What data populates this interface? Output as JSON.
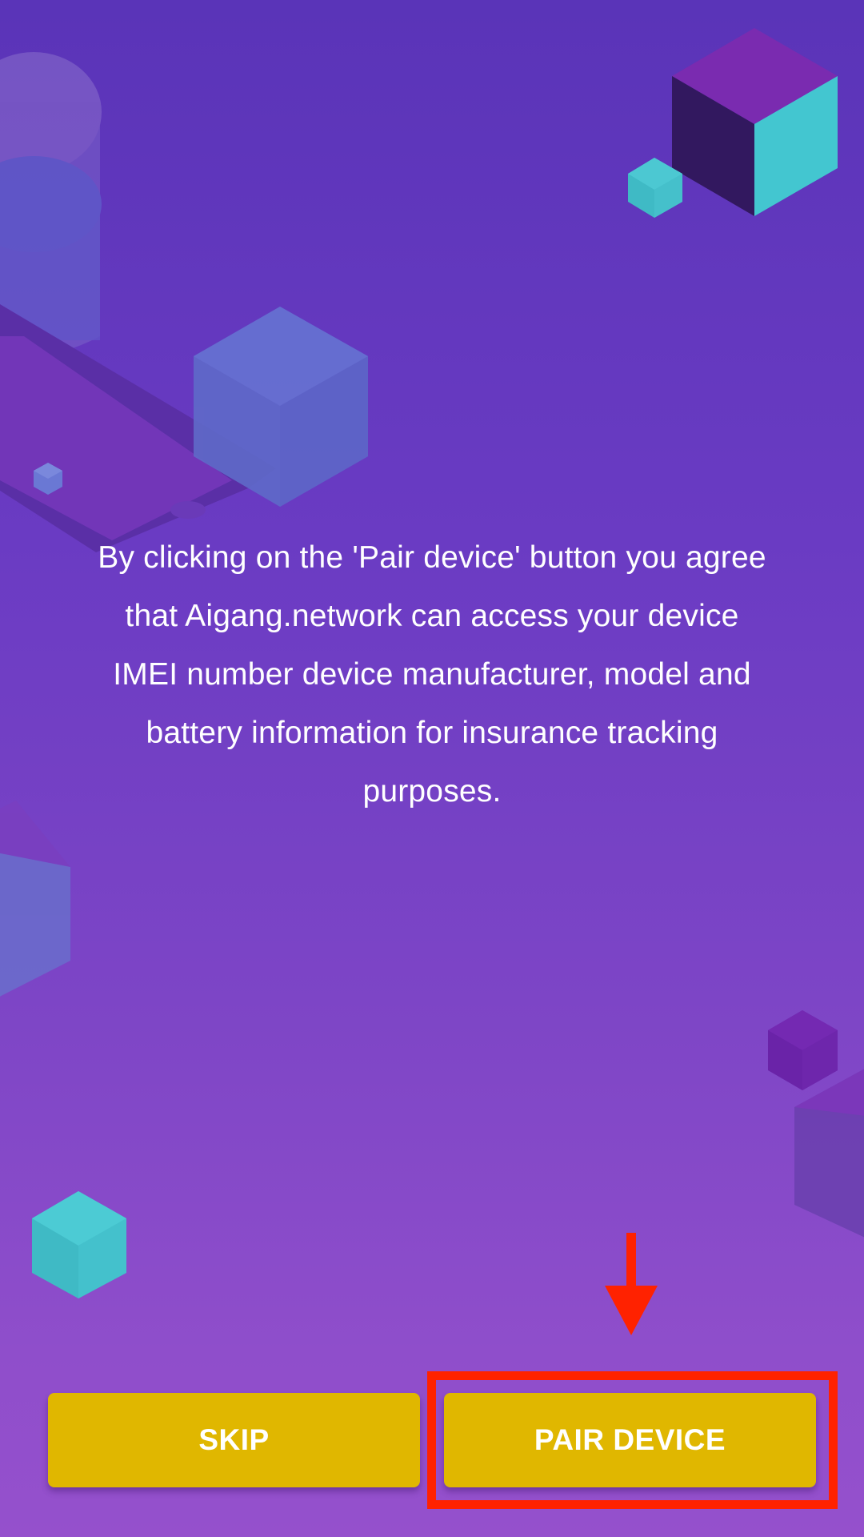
{
  "consent": {
    "message": "By clicking on the 'Pair device' button you agree that Aigang.network can access your device IMEI number device manufacturer, model and battery information for insurance tracking purposes."
  },
  "actions": {
    "skip_label": "SKIP",
    "pair_label": "PAIR DEVICE"
  },
  "theme": {
    "background_top": "#5a34b8",
    "background_bottom": "#9550cc",
    "button_color": "#e0b700",
    "button_text_color": "#ffffff",
    "highlight_color": "#ff2200"
  },
  "annotation": {
    "target": "pair-device-button"
  }
}
